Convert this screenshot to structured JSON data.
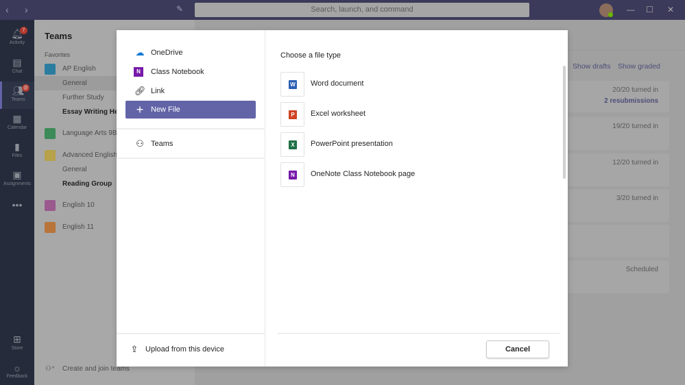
{
  "titlebar": {
    "search_placeholder": "Search, launch, and command"
  },
  "rail": [
    {
      "label": "Activity",
      "icon": "bell-icon",
      "badge": "7"
    },
    {
      "label": "Chat",
      "icon": "chat-icon"
    },
    {
      "label": "Teams",
      "icon": "teams-icon",
      "badge": "@"
    },
    {
      "label": "Calendar",
      "icon": "calendar-icon"
    },
    {
      "label": "Files",
      "icon": "file-icon"
    },
    {
      "label": "Assignments",
      "icon": "assignments-icon"
    },
    {
      "label": "Store",
      "icon": "store-icon"
    },
    {
      "label": "Feedback",
      "icon": "lightbulb-icon"
    }
  ],
  "teams": {
    "title": "Teams",
    "favorites": "Favorites",
    "items": [
      "AP English",
      "General",
      "Further Study",
      "Essay Writing He",
      "Language Arts 9B",
      "Advanced English",
      "General",
      "Reading Group",
      "English 10",
      "English 11"
    ],
    "create": "Create and join teams"
  },
  "main": {
    "show_drafts": "Show drafts",
    "show_graded": "Show graded",
    "cards": [
      "20/20 turned in",
      "19/20 turned in",
      "12/20 turned in",
      "3/20 turned in",
      "",
      "Scheduled"
    ],
    "resubmissions": "2 resubmissions"
  },
  "modal": {
    "sources": [
      {
        "label": "OneDrive",
        "icon": "onedrive-icon"
      },
      {
        "label": "Class Notebook",
        "icon": "onenote-icon"
      },
      {
        "label": "Link",
        "icon": "link-icon"
      },
      {
        "label": "New File",
        "icon": "plus-icon",
        "selected": true
      }
    ],
    "teams": "Teams",
    "upload": "Upload from this device",
    "heading": "Choose a file type",
    "file_types": [
      {
        "label": "Word document",
        "glyph": "W",
        "color": "#2b5fb4"
      },
      {
        "label": "Excel worksheet",
        "glyph": "P",
        "color": "#d04423"
      },
      {
        "label": "PowerPoint presentation",
        "glyph": "X",
        "color": "#1e7145"
      },
      {
        "label": "OneNote Class Notebook page",
        "glyph": "N",
        "color": "#7719aa"
      }
    ],
    "cancel": "Cancel"
  },
  "colors": {
    "accent": "#6264a7"
  }
}
